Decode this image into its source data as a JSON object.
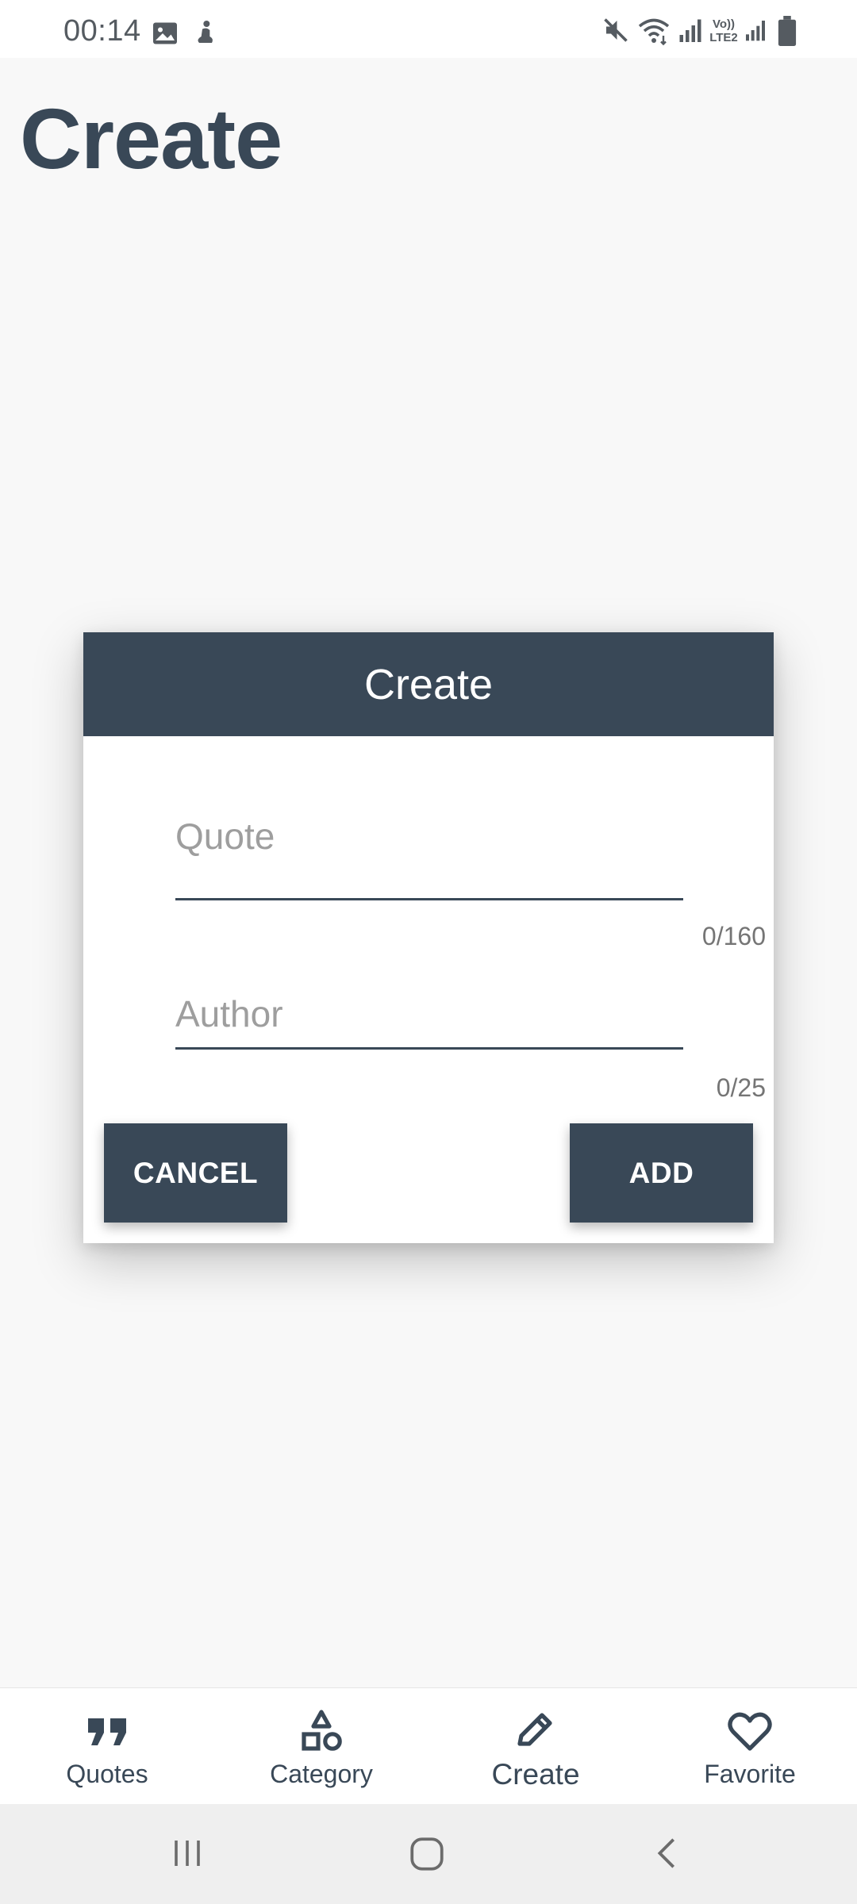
{
  "status_bar": {
    "time": "00:14",
    "left_icons": [
      "image-icon",
      "notification-figure-icon"
    ],
    "right_icons": [
      "mute-icon",
      "wifi-icon",
      "signal-icon",
      "volte-lte2-icon",
      "signal-icon",
      "battery-icon"
    ],
    "network_label_top": "Vo))",
    "network_label_bottom": "LTE2"
  },
  "page": {
    "title": "Create"
  },
  "dialog": {
    "title": "Create",
    "quote": {
      "value": "",
      "placeholder": "Quote",
      "counter": "0/160"
    },
    "author": {
      "value": "",
      "placeholder": "Author",
      "counter": "0/25"
    },
    "cancel_label": "CANCEL",
    "add_label": "ADD"
  },
  "bottom_nav": {
    "items": [
      {
        "label": "Quotes",
        "icon": "quotes-icon",
        "active": false
      },
      {
        "label": "Category",
        "icon": "category-shapes-icon",
        "active": false
      },
      {
        "label": "Create",
        "icon": "pencil-icon",
        "active": true
      },
      {
        "label": "Favorite",
        "icon": "heart-icon",
        "active": false
      }
    ]
  },
  "system_nav": {
    "buttons": [
      "recent-apps-icon",
      "home-icon",
      "back-icon"
    ]
  },
  "colors": {
    "primary": "#394857",
    "background": "#f8f8f8",
    "surface": "#ffffff",
    "placeholder": "#9e9e9e",
    "counter": "#757575"
  }
}
